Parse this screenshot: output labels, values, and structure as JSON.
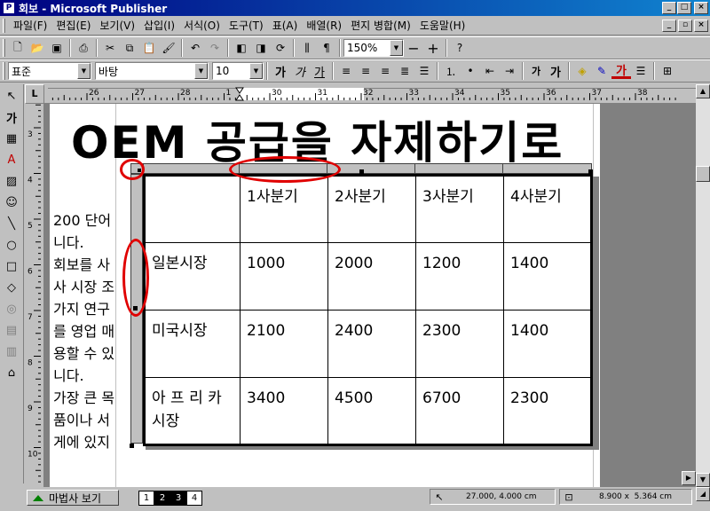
{
  "window": {
    "title": "회보 - Microsoft Publisher",
    "app_icon": "P"
  },
  "menu": [
    "파일(F)",
    "편집(E)",
    "보기(V)",
    "삽입(I)",
    "서식(O)",
    "도구(T)",
    "표(A)",
    "배열(R)",
    "편지 병합(M)",
    "도움말(H)"
  ],
  "toolbar": {
    "zoom": "150%"
  },
  "format": {
    "style": "표준",
    "font": "바탕",
    "size": "10",
    "text_buttons": [
      "가",
      "가",
      "가"
    ],
    "grow_shrink": [
      "가",
      "가"
    ],
    "color_label": "가"
  },
  "objtools": {
    "text_label": "가"
  },
  "ruler": {
    "h_labels": [
      "26",
      "27",
      "28",
      "1",
      "30",
      "31",
      "32",
      "33",
      "34",
      "35",
      "36",
      "37",
      "38"
    ],
    "v_labels": [
      "3",
      "4",
      "5",
      "6",
      "7",
      "8",
      "9",
      "10",
      "11"
    ],
    "corner": "L"
  },
  "document": {
    "headline": "OEM 공급을 자제하기로",
    "body_lines": [
      "200 단어",
      "니다.",
      "회보를 사",
      "사 시장 조",
      "가지 연구",
      "를 영업 매",
      "용할 수 있",
      "니다.",
      "가장 큰 목",
      "품이나 서",
      "게에 있지"
    ]
  },
  "table": {
    "header": [
      "",
      "1사분기",
      "2사분기",
      "3사분기",
      "4사분기"
    ],
    "rows": [
      [
        "일본시장",
        "1000",
        "2000",
        "1200",
        "1400"
      ],
      [
        "미국시장",
        "2100",
        "2400",
        "2300",
        "1400"
      ],
      [
        "아 프 리 카 시장",
        "3400",
        "4500",
        "6700",
        "2300"
      ]
    ]
  },
  "statusbar": {
    "wizard_label": "마법사 보기",
    "pages": [
      "1",
      "2",
      "3",
      "4"
    ],
    "position": "27.000, 4.000 cm",
    "size": "8.900 x  5.364 cm"
  },
  "colors": {
    "title_bar": "#000080",
    "annotation": "#e00000",
    "face": "#c0c0c0"
  }
}
